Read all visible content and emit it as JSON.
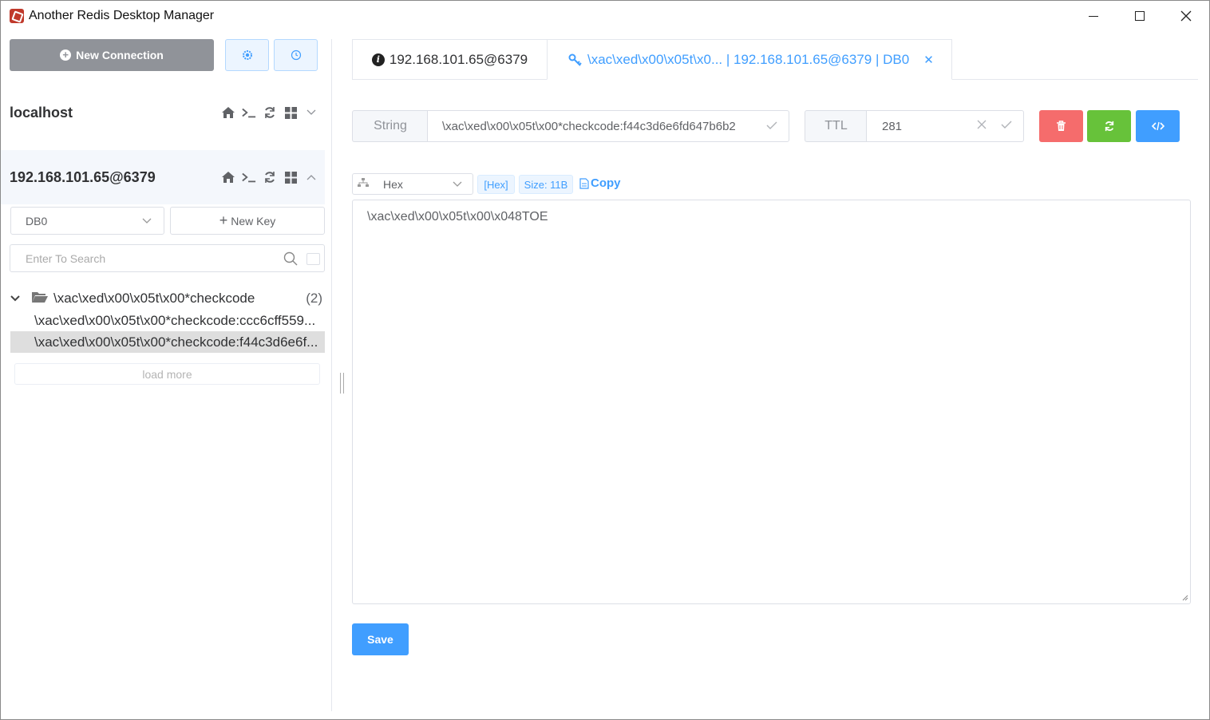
{
  "window": {
    "title": "Another Redis Desktop Manager"
  },
  "sidebar": {
    "new_connection_label": "New Connection",
    "connections": [
      {
        "name": "localhost"
      },
      {
        "name": "192.168.101.65@6379"
      }
    ],
    "db_select_value": "DB0",
    "new_key_label": "New Key",
    "search_placeholder": "Enter To Search",
    "tree": {
      "folder_name": "\\xac\\xed\\x00\\x05t\\x00*checkcode",
      "folder_count": "(2)",
      "items": [
        "\\xac\\xed\\x00\\x05t\\x00*checkcode:ccc6cff559...",
        "\\xac\\xed\\x00\\x05t\\x00*checkcode:f44c3d6e6f..."
      ]
    },
    "load_more_label": "load more"
  },
  "tabs": [
    {
      "label": "192.168.101.65@6379",
      "icon": "info-icon"
    },
    {
      "label": "\\xac\\xed\\x00\\x05t\\x0... | 192.168.101.65@6379 | DB0",
      "icon": "key-icon"
    }
  ],
  "key_detail": {
    "type_label": "String",
    "key_name": "\\xac\\xed\\x00\\x05t\\x00*checkcode:f44c3d6e6fd647b6b2",
    "ttl_label": "TTL",
    "ttl_value": "281",
    "format_value": "Hex",
    "format_tag": "[Hex]",
    "size_tag": "Size: 11B",
    "copy_label": "Copy",
    "value": "\\xac\\xed\\x00\\x05t\\x00\\x048TOE",
    "save_label": "Save"
  },
  "colors": {
    "primary": "#409eff",
    "danger": "#f56c6c",
    "success": "#67c23a",
    "info": "#909399"
  }
}
